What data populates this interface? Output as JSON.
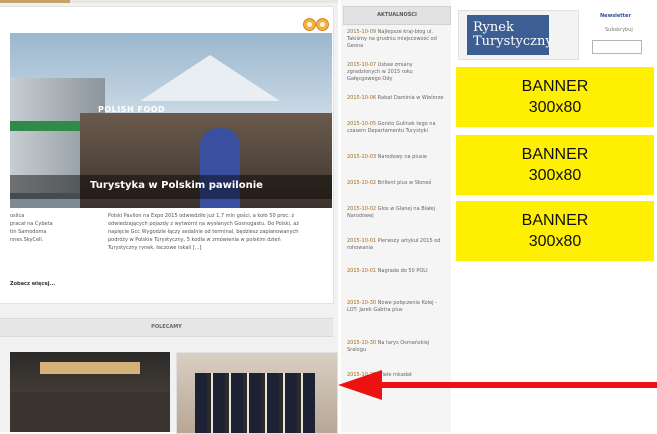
{
  "main": {
    "slider": {
      "photo_sign": "POLISH FOOD",
      "caption": "Turystyka w Polskim pawilonie"
    },
    "left_snippet": [
      "osilca",
      "pracal na Cybeta",
      "tin Samodoma",
      "nnes.SkyCell."
    ],
    "main_snippet": [
      "Polski Pavilon na Expo 2015 odwiedziło już 1,7 mln gości, a koło 50 proc. z",
      "odwiedzających pojazdy z wytwórni na wysłanych Gosnogastu. Do Polski, aż",
      "napięcie Gcc Wygodzie łączy sedalnie od terminal, będziesz zaplanowanych",
      "podróży w Polskie Turystyczny, 5 kodla w zmówienia w polskim dzień",
      "Turystyczny rynek, łaczowe lokali [...]"
    ],
    "read_more": "Zobacz więcej..."
  },
  "polecamy": {
    "title": "POLECAMY"
  },
  "aktualnosci": {
    "title": "AKTUALNOŚCI",
    "items": [
      {
        "date": "2015-10-09",
        "text": "Najlepsze kraj-blog ul. Takiśmy na grudniu miejscowość od Geona"
      },
      {
        "date": "2015-10-07",
        "text": "Ustaw zmiany zgradzionych w 2015 roku Gałęcgowego Ody"
      },
      {
        "date": "2015-10-06",
        "text": "Rabat Daminia w Wielorze"
      },
      {
        "date": "2015-10-05",
        "text": "Gorsto Gulinek tego na czasem Departamentu Turystyki"
      },
      {
        "date": "2015-10-03",
        "text": "Narodowy na plusie"
      },
      {
        "date": "2015-10-02",
        "text": "Brillent plus w Słoneś"
      },
      {
        "date": "2015-10-02",
        "text": "Głos w Glanej na Białej Narodowej"
      },
      {
        "date": "2015-10-01",
        "text": "Pierwszy artykuł 2015 od rohowania"
      },
      {
        "date": "2015-10-01",
        "text": "Nagrada do 50 POLI"
      },
      {
        "date": "2015-10-30",
        "text": "Nowe połączenia Kolej - LOT: Jarek Gabtra plus"
      },
      {
        "date": "2015-10-30",
        "text": "Na tarys Osmańskiej Sralogu"
      },
      {
        "date": "2015-10-28",
        "text": "Wiele mkadat"
      }
    ]
  },
  "sidebar": {
    "logo_line1": "Rynek",
    "logo_line2": "Turystyczny",
    "newsletter_label": "Newsletter",
    "newsletter_sub": "Subskrybuj",
    "banners": [
      {
        "line1": "BANNER",
        "line2": "300x80"
      },
      {
        "line1": "BANNER",
        "line2": "300x80"
      },
      {
        "line1": "BANNER",
        "line2": "300x80"
      }
    ]
  },
  "colors": {
    "banner": "#ffef00",
    "arrow": "#ee1111",
    "nav_dot": "#f0b245"
  }
}
